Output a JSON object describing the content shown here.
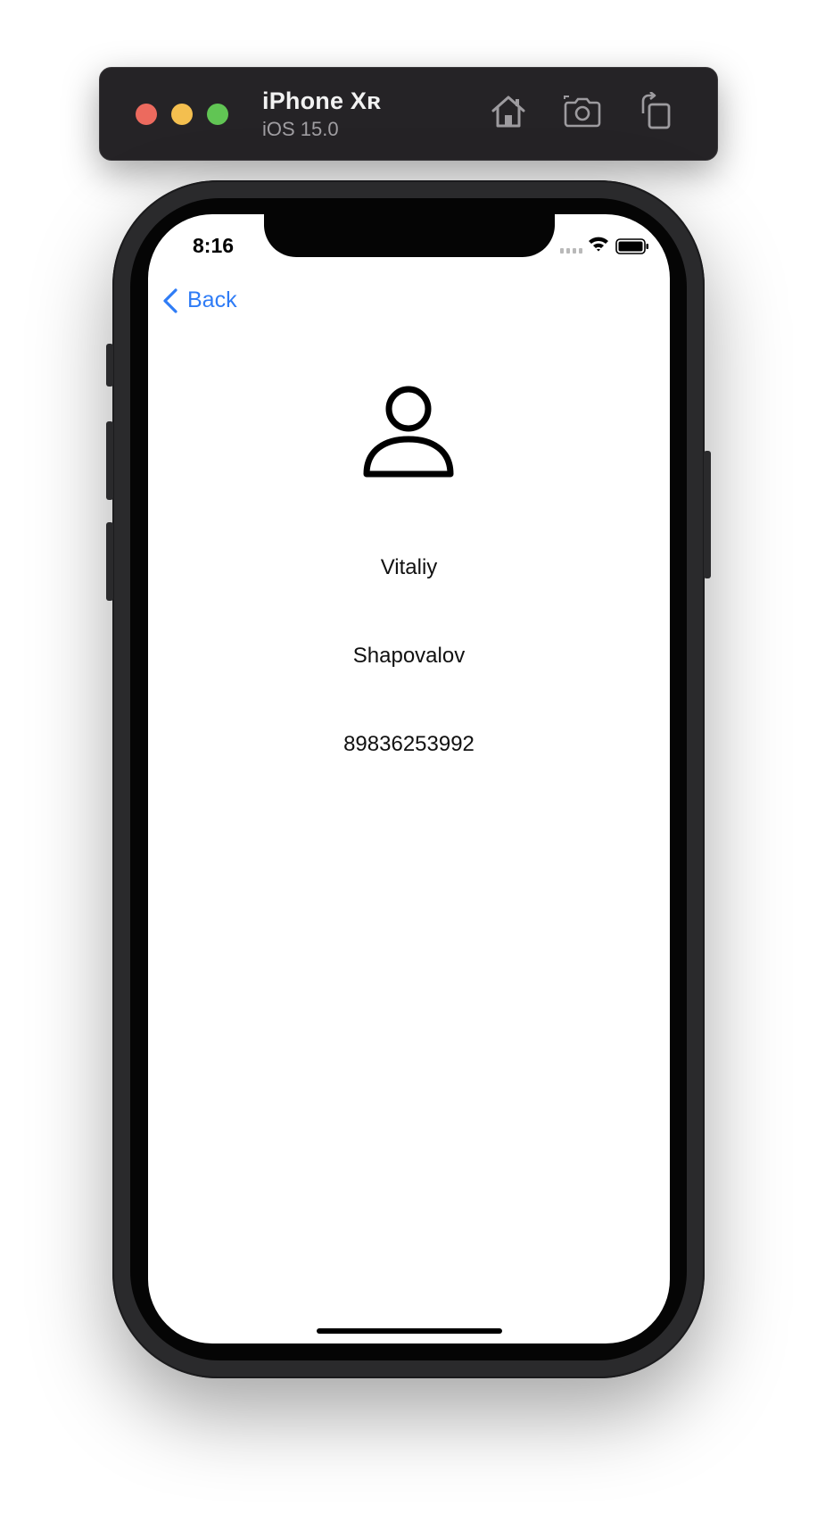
{
  "simulator": {
    "device_name": "iPhone Xʀ",
    "os_version": "iOS 15.0",
    "icons": [
      "home-icon",
      "screenshot-icon",
      "rotate-icon"
    ]
  },
  "status_bar": {
    "time": "8:16"
  },
  "nav": {
    "back_label": "Back"
  },
  "profile": {
    "first_name": "Vitaliy",
    "last_name": "Shapovalov",
    "phone": "89836253992"
  },
  "colors": {
    "accent": "#2f7cf6",
    "simulator_bar": "#252326"
  }
}
